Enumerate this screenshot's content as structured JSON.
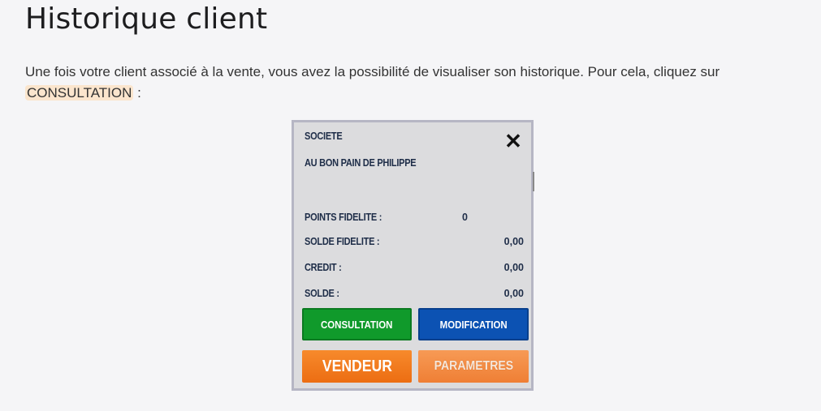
{
  "page": {
    "title": "Historique client",
    "paragraph_before": "Une fois votre client associé à la vente, vous avez la possibilité de visualiser son historique. Pour cela, cliquez sur ",
    "paragraph_highlight": "CONSULTATION",
    "paragraph_after": " :"
  },
  "panel": {
    "header_label": "SOCIETE",
    "company_name": "AU BON PAIN DE PHILIPPE",
    "close_icon": "✕",
    "rows": [
      {
        "label": "POINTS FIDELITE :",
        "value": "0"
      },
      {
        "label": "SOLDE FIDELITE :",
        "value": "0,00"
      },
      {
        "label": "CREDIT :",
        "value": "0,00"
      },
      {
        "label": "SOLDE :",
        "value": "0,00"
      }
    ],
    "buttons": {
      "consultation": "CONSULTATION",
      "modification": "MODIFICATION",
      "vendeur": "VENDEUR",
      "parametres": "PARAMETRES"
    }
  },
  "colors": {
    "consultation_green": "#109a2b",
    "modification_blue": "#0c52b3",
    "orange": "#ec6d12",
    "highlight": "#fbe5cd"
  }
}
